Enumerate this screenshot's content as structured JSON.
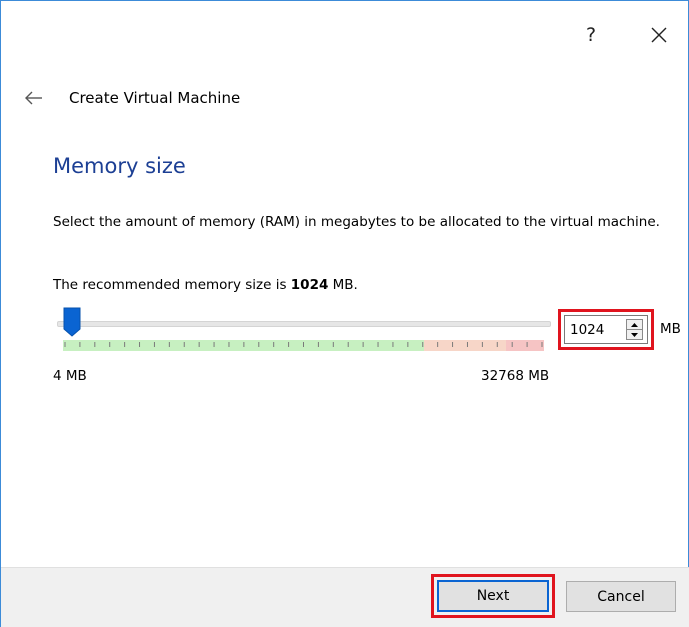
{
  "titlebar": {
    "help_label": "?",
    "close_icon": "close-icon"
  },
  "header": {
    "back_icon": "back-arrow-icon",
    "title": "Create Virtual Machine"
  },
  "section": {
    "title": "Memory size",
    "description": "Select the amount of memory (RAM) in megabytes to be allocated to the virtual machine.",
    "recommend_prefix": "The recommended memory size is ",
    "recommend_value": "1024",
    "recommend_suffix": " MB."
  },
  "slider": {
    "min_label": "4 MB",
    "max_label": "32768 MB",
    "value": 1024,
    "min": 4,
    "max": 32768,
    "accent_color": "#0a64d2",
    "green_color": "#c7f0c1",
    "orange_color": "#f7d6c8",
    "red_color": "#f6c4c4"
  },
  "spinbox": {
    "value": "1024",
    "unit": "MB",
    "highlight_color": "#e0141e"
  },
  "footer": {
    "next_label": "Next",
    "cancel_label": "Cancel"
  }
}
